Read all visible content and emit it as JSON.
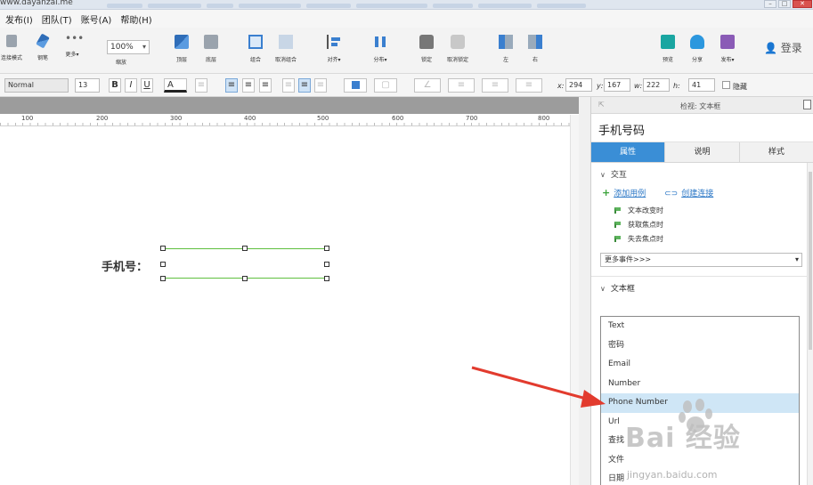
{
  "window": {
    "url": "www.dayanzai.me",
    "controls": [
      "–",
      "□",
      "✕"
    ]
  },
  "menu": [
    "发布(I)",
    "团队(T)",
    "账号(A)",
    "帮助(H)"
  ],
  "toolbar": {
    "zoom_value": "100%",
    "zoom_label": "缩放",
    "login_label": "登录",
    "buttons": [
      {
        "label": "连接模式",
        "icon": "connector-icon"
      },
      {
        "label": "钢笔",
        "icon": "pen-icon"
      },
      {
        "label": "更多▾",
        "icon": "more-icon"
      },
      {
        "label": "顶层",
        "icon": "bring-front-icon"
      },
      {
        "label": "底层",
        "icon": "send-back-icon"
      },
      {
        "label": "组合",
        "icon": "group-icon"
      },
      {
        "label": "取消组合",
        "icon": "ungroup-icon"
      },
      {
        "label": "对齐▾",
        "icon": "align-icon"
      },
      {
        "label": "分布▾",
        "icon": "distribute-icon"
      },
      {
        "label": "锁定",
        "icon": "lock-icon"
      },
      {
        "label": "取消锁定",
        "icon": "unlock-icon"
      },
      {
        "label": "左",
        "icon": "left-icon"
      },
      {
        "label": "右",
        "icon": "right-icon"
      },
      {
        "label": "预览",
        "icon": "preview-icon"
      },
      {
        "label": "分享",
        "icon": "share-icon"
      },
      {
        "label": "发布▾",
        "icon": "publish-icon"
      }
    ]
  },
  "format": {
    "style": "Normal",
    "font_size": "13",
    "bold": "B",
    "italic": "I",
    "underline": "U",
    "font_color": "A",
    "x_label": "x:",
    "x": "294",
    "y_label": "y:",
    "y": "167",
    "w_label": "w:",
    "w": "222",
    "h_label": "h:",
    "h": "41",
    "hidden_label": "隐藏"
  },
  "ruler": [
    "100",
    "200",
    "300",
    "400",
    "500",
    "600",
    "700",
    "800"
  ],
  "canvas": {
    "field_label": "手机号："
  },
  "panel": {
    "header": "检视: 文本框",
    "widget_name": "手机号码",
    "tabs": [
      "属性",
      "说明",
      "样式"
    ],
    "interaction_title": "交互",
    "add_case": "添加用例",
    "create_link": "创建连接",
    "events": [
      "文本改变时",
      "获取焦点时",
      "失去焦点时"
    ],
    "more_events": "更多事件>>>",
    "textbox_title": "文本框",
    "type_options": [
      "Text",
      "密码",
      "Email",
      "Number",
      "Phone Number",
      "Url",
      "查找",
      "文件",
      "日期"
    ],
    "selected_option": "Phone Number"
  },
  "watermark": {
    "text": "Bai 经验",
    "sub": "jingyan.baidu.com"
  }
}
